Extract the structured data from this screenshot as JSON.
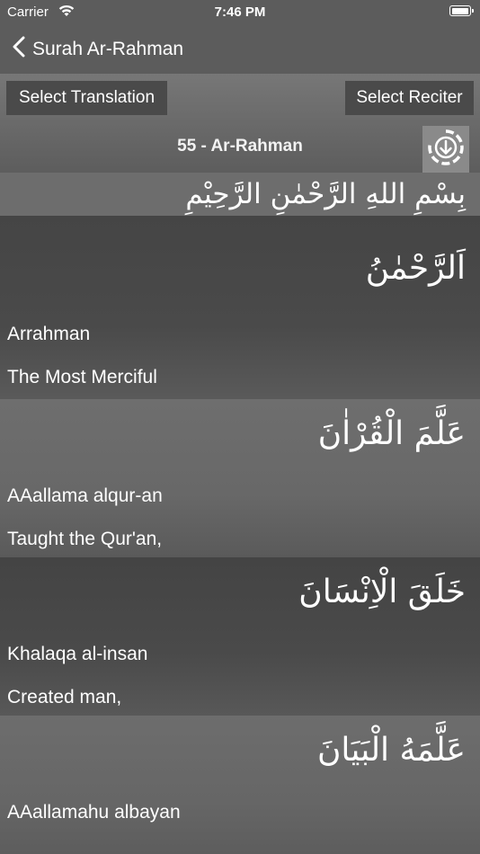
{
  "status": {
    "carrier": "Carrier",
    "time": "7:46 PM",
    "battery_level": 1.0
  },
  "nav": {
    "back_title": "Surah Ar-Rahman"
  },
  "controls": {
    "select_translation": "Select Translation",
    "select_reciter": "Select Reciter",
    "surah_title": "55 - Ar-Rahman"
  },
  "bismillah": "بِسْمِ اللهِ الرَّحْمٰنِ الرَّحِيْمِ",
  "verses": [
    {
      "arabic": "اَلرَّحْمٰنُ",
      "transliteration": "Arrahman",
      "translation": "The Most Merciful"
    },
    {
      "arabic": "عَلَّمَ الْقُرْاٰنَ",
      "transliteration": "AAallama alqur-an",
      "translation": "Taught the Qur'an,"
    },
    {
      "arabic": "خَلَقَ الْاِنْسَانَ",
      "transliteration": "Khalaqa al-insan",
      "translation": "Created man,"
    },
    {
      "arabic": "عَلَّمَهُ الْبَيَانَ",
      "transliteration": "AAallamahu albayan",
      "translation": ""
    }
  ],
  "icons": {
    "wifi": "wifi-icon",
    "battery": "battery-icon",
    "back": "chevron-left-icon",
    "download": "download-icon"
  }
}
